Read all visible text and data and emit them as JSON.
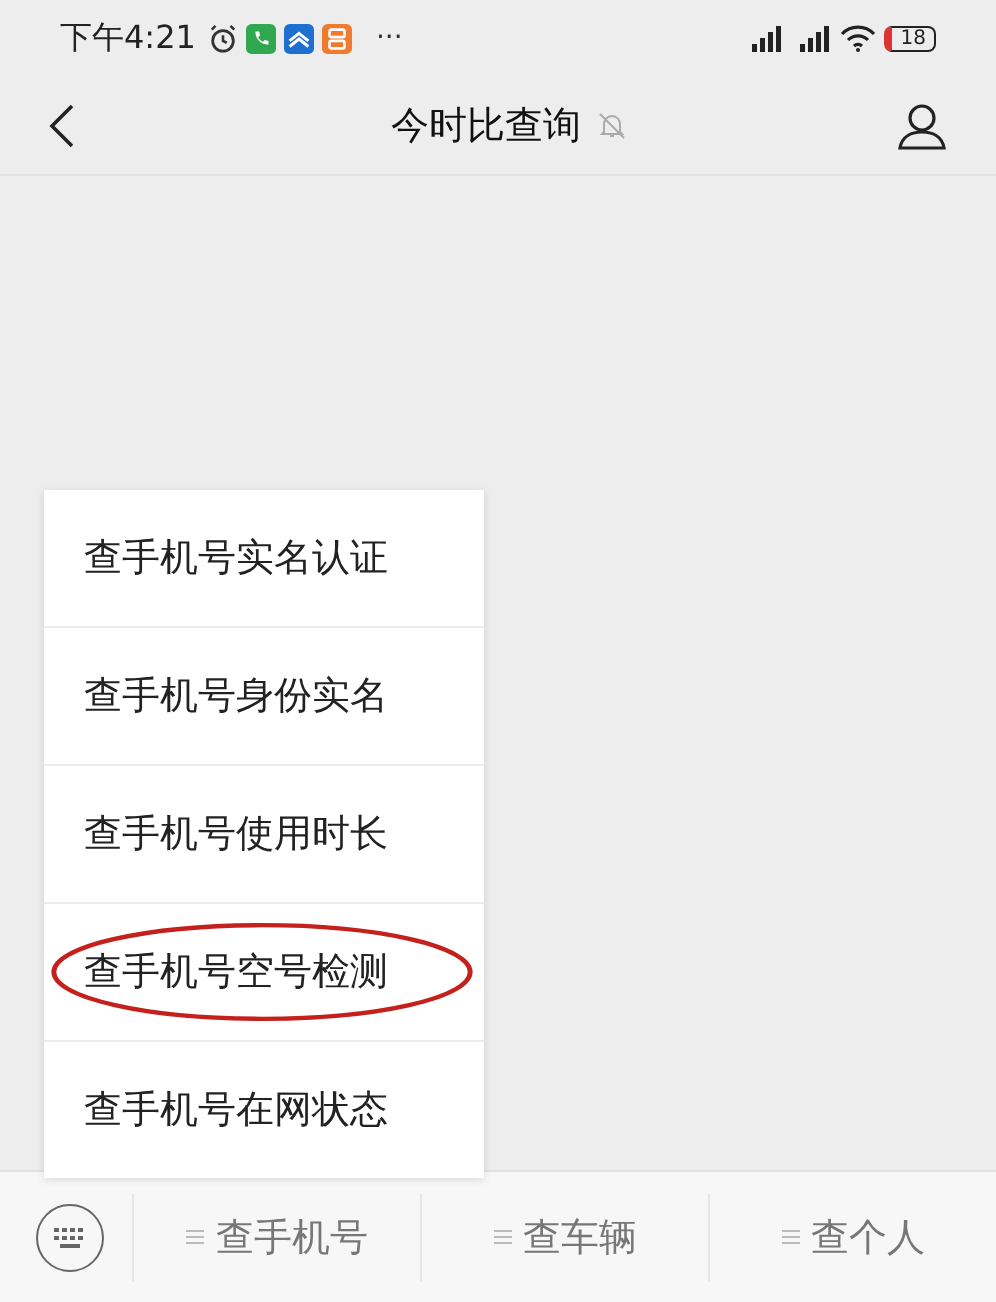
{
  "status_bar": {
    "time": "下午4:21",
    "more": "···",
    "battery": "18"
  },
  "header": {
    "title": "今时比查询",
    "muted": true
  },
  "menu": {
    "items": [
      {
        "label": "查手机号实名认证",
        "circled": false
      },
      {
        "label": "查手机号身份实名",
        "circled": false
      },
      {
        "label": "查手机号使用时长",
        "circled": false
      },
      {
        "label": "查手机号空号检测",
        "circled": true
      },
      {
        "label": "查手机号在网状态",
        "circled": false
      }
    ]
  },
  "bottom_menu": {
    "tabs": [
      {
        "label": "查手机号"
      },
      {
        "label": "查车辆"
      },
      {
        "label": "查个人"
      }
    ]
  }
}
